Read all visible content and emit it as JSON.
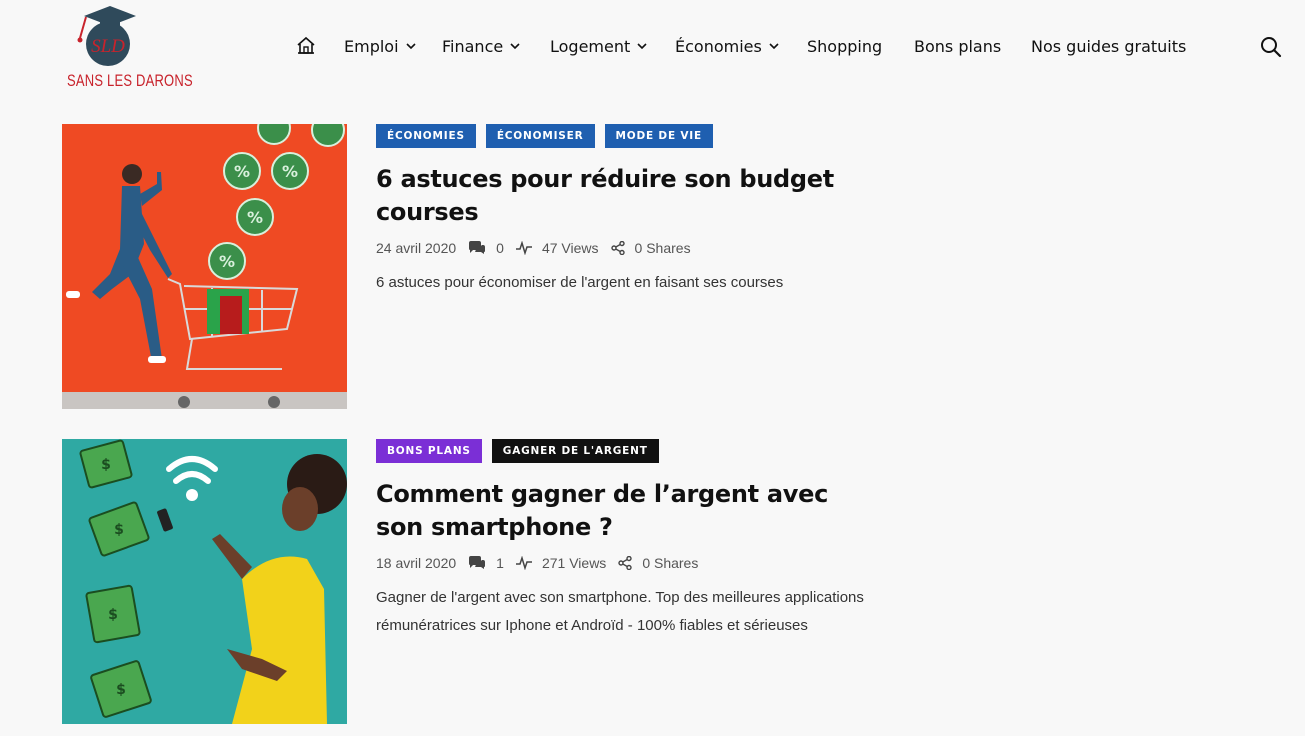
{
  "header": {
    "logo_initials": "SLD",
    "logo_text": "SANS LES DARONS",
    "nav": [
      {
        "label": "Emploi",
        "has_dropdown": true
      },
      {
        "label": "Finance",
        "has_dropdown": true
      },
      {
        "label": "Logement",
        "has_dropdown": true
      },
      {
        "label": "Économies",
        "has_dropdown": true
      },
      {
        "label": "Shopping",
        "has_dropdown": false
      },
      {
        "label": "Bons plans",
        "has_dropdown": false
      },
      {
        "label": "Nos guides gratuits",
        "has_dropdown": false
      }
    ],
    "icons": [
      "home-icon",
      "search-icon"
    ]
  },
  "articles": [
    {
      "tags": [
        {
          "label": "Économies",
          "color": "#1f5fb0"
        },
        {
          "label": "Économiser",
          "color": "#1f5fb0"
        },
        {
          "label": "Mode de vie",
          "color": "#1f5fb0"
        }
      ],
      "title": "6 astuces pour réduire son budget courses",
      "date": "24 avril 2020",
      "comments": "0",
      "views": "47 Views",
      "shares": "0 Shares",
      "excerpt": "6 astuces pour économiser de l'argent en faisant ses courses",
      "image_bg": "#ef4a23"
    },
    {
      "tags": [
        {
          "label": "Bons plans",
          "color": "#7b2fd6"
        },
        {
          "label": "Gagner de l'argent",
          "color": "#111111"
        }
      ],
      "title": "Comment gagner de l’argent avec son smartphone ?",
      "date": "18 avril 2020",
      "comments": "1",
      "views": "271 Views",
      "shares": "0 Shares",
      "excerpt": "Gagner de l'argent avec son smartphone. Top des meilleures applications rémunératrices sur Iphone et Androïd - 100% fiables et sérieuses",
      "image_bg": "#2fa9a3"
    }
  ]
}
